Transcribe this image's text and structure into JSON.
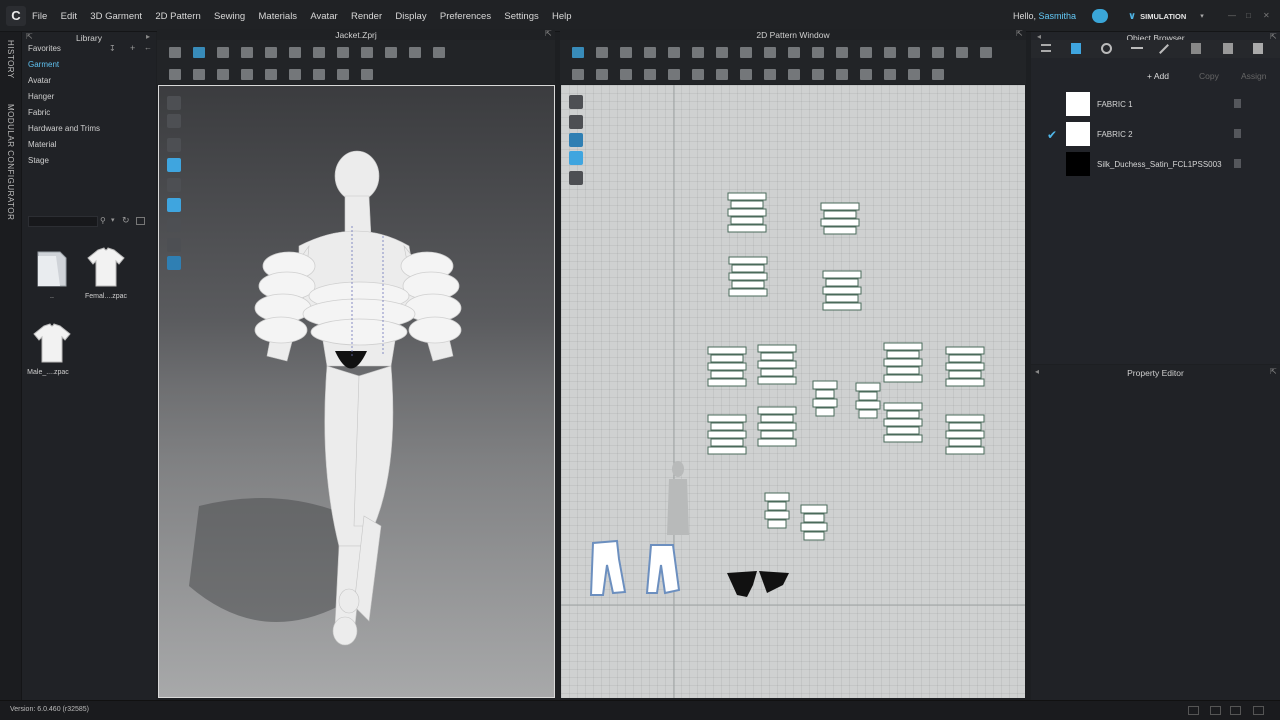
{
  "app": {
    "logo": "C",
    "menu": [
      "File",
      "Edit",
      "3D Garment",
      "2D Pattern",
      "Sewing",
      "Materials",
      "Avatar",
      "Render",
      "Display",
      "Preferences",
      "Settings",
      "Help"
    ],
    "greeting": "Hello,",
    "username": "Sasmitha",
    "mode_button": "SIMULATION"
  },
  "side_tabs": {
    "history": "HISTORY",
    "modular": "MODULAR CONFIGURATOR"
  },
  "library": {
    "title": "Library",
    "tree": [
      "Favorites",
      "Garment",
      "Avatar",
      "Hanger",
      "Fabric",
      "Hardware and Trims",
      "Material",
      "Stage"
    ],
    "active": "Garment",
    "items": [
      {
        "label": "..",
        "icon": "folder-icon"
      },
      {
        "label": "Femal....zpac",
        "icon": "tshirt-icon"
      },
      {
        "label": "Male_....zpac",
        "icon": "tshirt-icon"
      }
    ]
  },
  "viewport3d": {
    "title": "Jacket.Zprj"
  },
  "pattern2d": {
    "title": "2D Pattern Window"
  },
  "object_browser": {
    "title": "Object Browser",
    "add_label": "Add",
    "copy_label": "Copy",
    "assign_label": "Assign",
    "fabrics": [
      {
        "name": "FABRIC 1",
        "color": "#ffffff",
        "selected": false
      },
      {
        "name": "FABRIC 2",
        "color": "#ffffff",
        "selected": true
      },
      {
        "name": "Silk_Duchess_Satin_FCL1PSS003",
        "color": "#000000",
        "selected": false
      }
    ]
  },
  "property_editor": {
    "title": "Property Editor"
  },
  "status": {
    "version": "Version: 6.0.460 (r32585)"
  }
}
